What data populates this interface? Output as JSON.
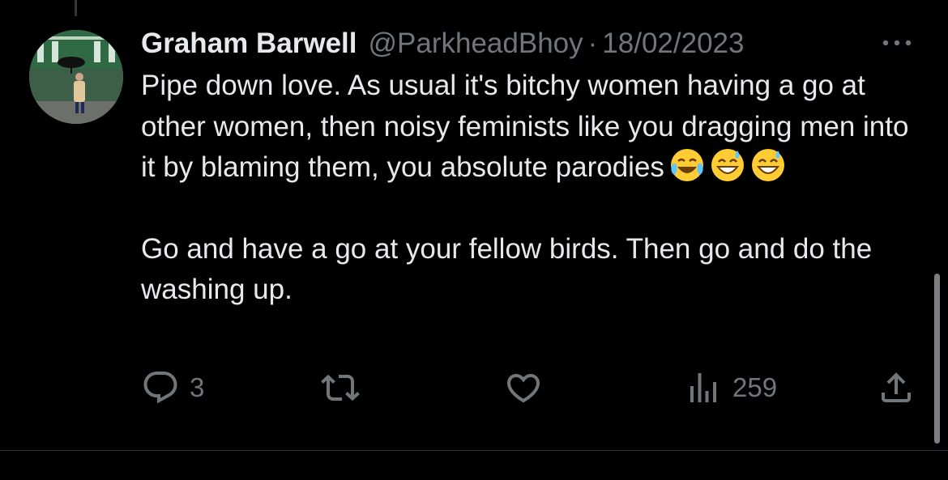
{
  "tweet": {
    "author_name": "Graham Barwell",
    "handle": "@ParkheadBhoy",
    "separator": "·",
    "date": "18/02/2023",
    "paragraph1": "Pipe down love. As usual it's bitchy women having a go at other women, then noisy feminists like you dragging men into it by blaming them, you absolute parodies",
    "paragraph1_emojis": [
      "tears-of-joy-emoji",
      "grinning-sweat-emoji",
      "grinning-sweat-emoji"
    ],
    "paragraph2": "Go and have a go at your fellow birds. Then go and do the washing up."
  },
  "actions": {
    "reply_count": "3",
    "retweet_count": "",
    "like_count": "",
    "views_count": "259"
  },
  "icons": [
    "more-options-icon",
    "reply-icon",
    "retweet-icon",
    "like-icon",
    "views-icon",
    "share-icon"
  ],
  "colors": {
    "background": "#000000",
    "text": "#e7e9ea",
    "secondary": "#71767b"
  }
}
